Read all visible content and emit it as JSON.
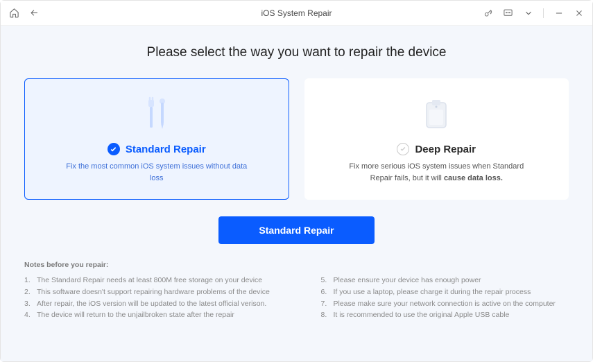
{
  "title": "iOS System Repair",
  "heading": "Please select the way you want to repair the device",
  "cards": {
    "standard": {
      "title": "Standard Repair",
      "desc": "Fix the most common iOS system issues without data loss"
    },
    "deep": {
      "title": "Deep Repair",
      "desc_prefix": "Fix more serious iOS system issues when Standard Repair fails, but it will ",
      "desc_bold": "cause data loss."
    }
  },
  "primary_button": "Standard Repair",
  "notes": {
    "title": "Notes before you repair:",
    "left": [
      "The Standard Repair needs at least 800M free storage on your device",
      "This software doesn't support repairing hardware problems of the device",
      "After repair, the iOS version will be updated to the latest official verison.",
      "The device will return to the unjailbroken state after the repair"
    ],
    "right": [
      "Please ensure your device has enough power",
      "If you use a laptop, please charge it during the repair process",
      "Please make sure your network connection is active on the computer",
      "It is recommended to use the original Apple USB cable"
    ]
  }
}
